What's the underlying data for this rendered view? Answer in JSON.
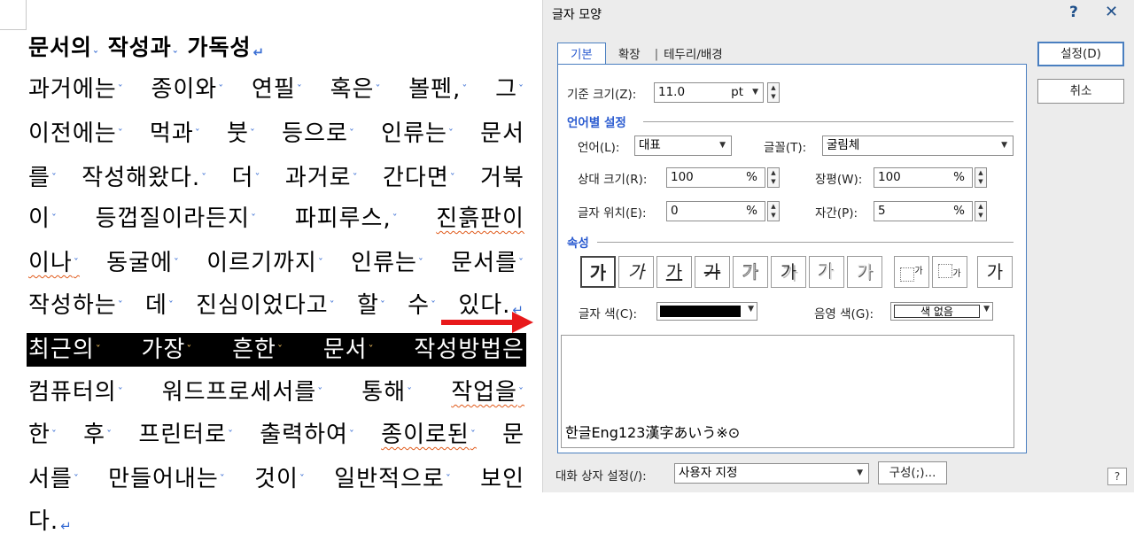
{
  "document": {
    "heading": [
      "문서의",
      "작성과",
      "가독성"
    ],
    "lines": [
      [
        "과거에는",
        "종이와",
        "연필",
        "혹은",
        "볼펜,",
        "그"
      ],
      [
        "이전에는",
        "먹과",
        "붓",
        "등으로",
        "인류는",
        "문서"
      ],
      [
        "를",
        "작성해왔다.",
        "더",
        "과거로",
        "간다면",
        "거북"
      ],
      [
        "이",
        "등껍질이라든지",
        "파피루스,",
        "진흙판이"
      ],
      [
        "이나",
        "동굴에",
        "이르기까지",
        "인류는",
        "문서를"
      ],
      [
        "작성하는",
        "데",
        "진심이었다고",
        "할",
        "수",
        "있다."
      ],
      [
        "최근의",
        "가장",
        "흔한",
        "문서",
        "작성방법은"
      ],
      [
        "컴퓨터의",
        "워드프로세서를",
        "통해",
        "작업을"
      ],
      [
        "한",
        "후",
        "프린터로",
        "출력하여",
        "종이로된",
        "문"
      ],
      [
        "서를",
        "만들어내는",
        "것이",
        "일반적으로",
        "보인"
      ],
      [
        "다."
      ]
    ]
  },
  "dialog": {
    "title": "글자 모양",
    "help": "?",
    "close": "✕",
    "tabs": [
      "기본",
      "확장",
      "테두리/배경"
    ],
    "tab_separator": "|",
    "base_size": {
      "label": "기준 크기(Z):",
      "value": "11.0",
      "unit": "pt"
    },
    "lang_section": "언어별 설정",
    "language": {
      "label": "언어(L):",
      "value": "대표"
    },
    "font": {
      "label": "글꼴(T):",
      "value": "굴림체"
    },
    "relative_size": {
      "label": "상대 크기(R):",
      "value": "100",
      "unit": "%"
    },
    "width": {
      "label": "장평(W):",
      "value": "100",
      "unit": "%"
    },
    "char_position": {
      "label": "글자 위치(E):",
      "value": "0",
      "unit": "%"
    },
    "spacing": {
      "label": "자간(P):",
      "value": "5",
      "unit": "%"
    },
    "attr_section": "속성",
    "attrs": [
      "가",
      "가",
      "가",
      "가",
      "가",
      "가",
      "가",
      "가",
      "가",
      "가",
      "가"
    ],
    "text_color": {
      "label": "글자 색(C):",
      "value": "#000000"
    },
    "shade_color": {
      "label": "음영 색(G):",
      "value": "색 없음"
    },
    "preview_text": "한글Eng123漢字あいう※⊙",
    "set_button": "설정(D)",
    "cancel_button": "취소",
    "dialog_setting": {
      "label": "대화 상자 설정(/):",
      "value": "사용자 지정"
    },
    "config_button": "구성(;)...",
    "bottom_help": "?"
  },
  "colors": {
    "accent": "#2a5bd0",
    "tab_border": "#4a7fc0",
    "highlight_bg": "#000000",
    "arrow": "#e8191b",
    "spell_underline": "#e05a1a",
    "space_marker": "#3b6fd4"
  }
}
